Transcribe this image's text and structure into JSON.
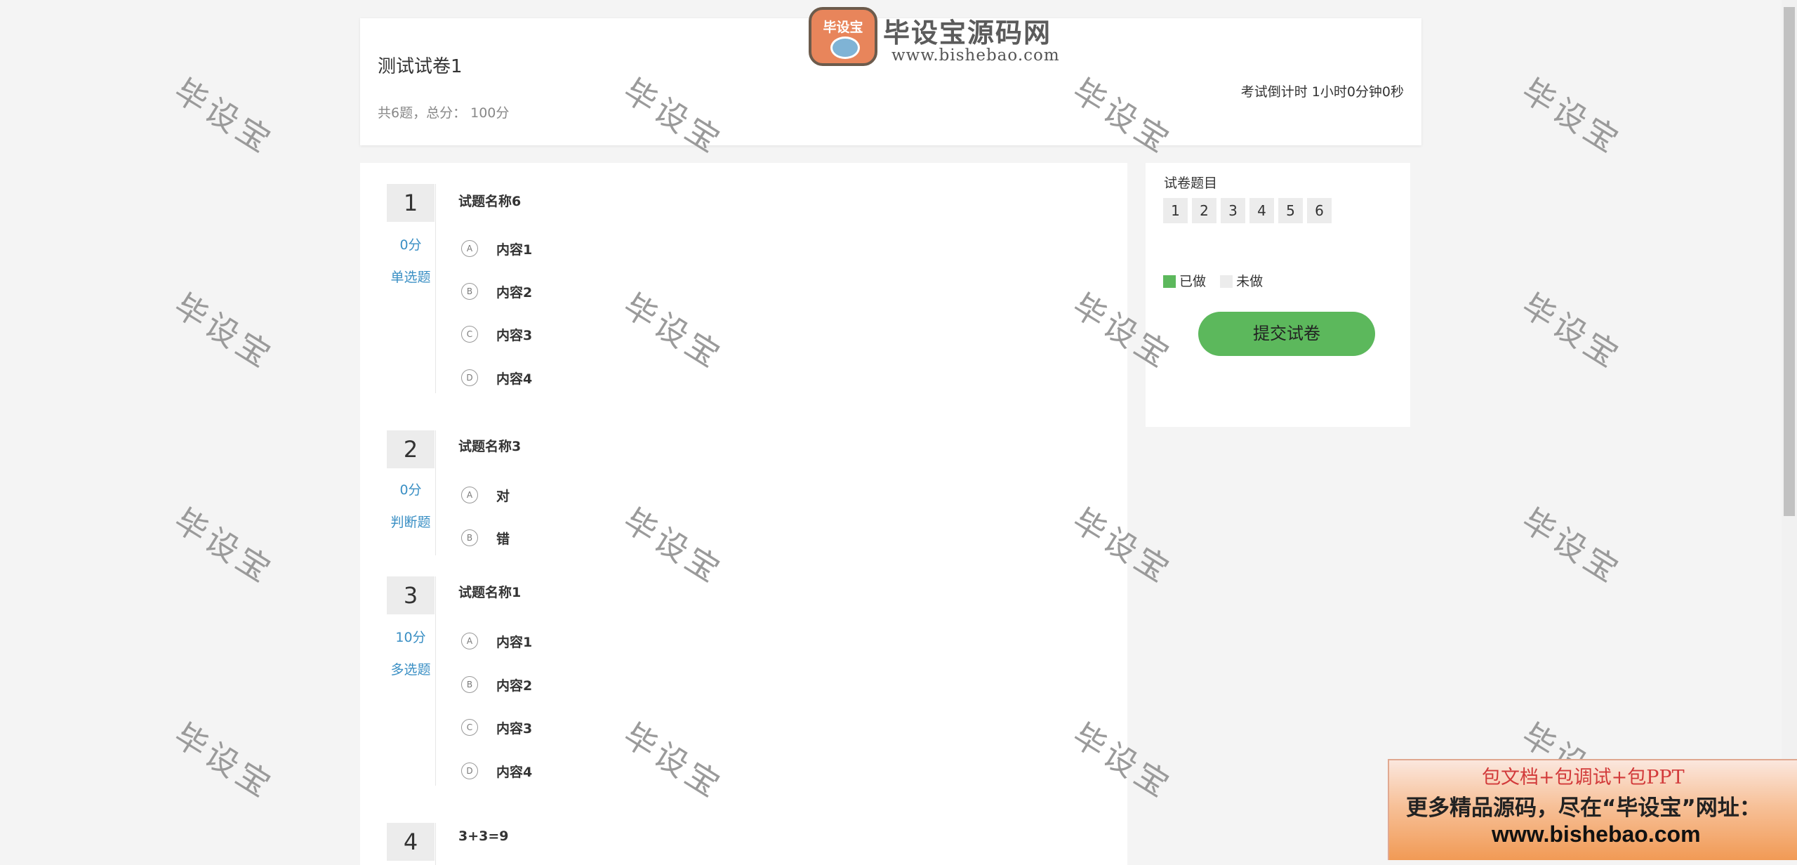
{
  "watermark": "毕设宝",
  "logo": {
    "badge_text": "毕设宝",
    "name": "毕设宝源码网",
    "url": "www.bishebao.com"
  },
  "exam": {
    "title": "测试试卷1",
    "meta": "共6题，总分： 100分",
    "countdown": "考试倒计时 1小时0分钟0秒"
  },
  "questions": [
    {
      "number": "1",
      "score": "0分",
      "type": "单选题",
      "title": "试题名称6",
      "options": [
        {
          "letter": "A",
          "text": "内容1"
        },
        {
          "letter": "B",
          "text": "内容2"
        },
        {
          "letter": "C",
          "text": "内容3"
        },
        {
          "letter": "D",
          "text": "内容4"
        }
      ]
    },
    {
      "number": "2",
      "score": "0分",
      "type": "判断题",
      "title": "试题名称3",
      "options": [
        {
          "letter": "A",
          "text": "对"
        },
        {
          "letter": "B",
          "text": "错"
        }
      ]
    },
    {
      "number": "3",
      "score": "10分",
      "type": "多选题",
      "title": "试题名称1",
      "options": [
        {
          "letter": "A",
          "text": "内容1"
        },
        {
          "letter": "B",
          "text": "内容2"
        },
        {
          "letter": "C",
          "text": "内容3"
        },
        {
          "letter": "D",
          "text": "内容4"
        }
      ]
    },
    {
      "number": "4",
      "title": "3+3=9"
    }
  ],
  "sidebar": {
    "title": "试卷题目",
    "nav": [
      "1",
      "2",
      "3",
      "4",
      "5",
      "6"
    ],
    "legend_done": "已做",
    "legend_todo": "未做",
    "submit_label": "提交试卷",
    "colors": {
      "done": "#5cb85c",
      "todo": "#ececec",
      "accent": "#3a8fc4"
    }
  },
  "ad": {
    "line1": "包文档+包调试+包PPT",
    "line2": "更多精品源码，尽在“毕设宝”网址：",
    "line3": "www.bishebao.com"
  }
}
